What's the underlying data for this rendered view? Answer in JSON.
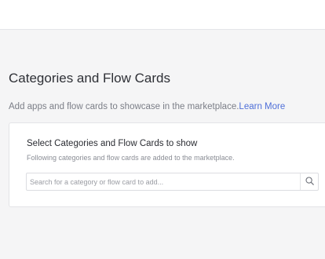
{
  "section": {
    "title": "Categories and Flow Cards",
    "description": "Add apps and flow cards to showcase in the marketplace.",
    "learn_more_label": "Learn More"
  },
  "card": {
    "title": "Select Categories and Flow Cards to show",
    "subtitle": "Following categories and flow cards are added to the marketplace.",
    "search": {
      "placeholder": "Search for a category or flow card to add...",
      "value": "",
      "icon": "search-icon"
    }
  },
  "colors": {
    "background": "#f5f5f6",
    "link": "#4f6fd8",
    "card_border": "#e3e4e7"
  }
}
